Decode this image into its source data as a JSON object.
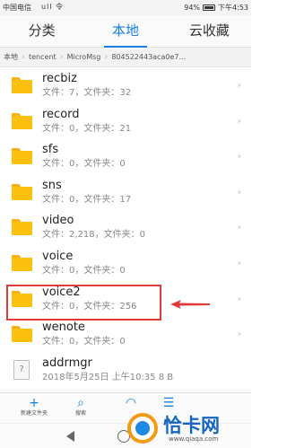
{
  "status_bar": {
    "carrier": "中国电信",
    "signal_icons": "ull 令",
    "battery": "94%",
    "time": "下午4:53"
  },
  "tabs": [
    {
      "label": "分类",
      "active": false
    },
    {
      "label": "本地",
      "active": true
    },
    {
      "label": "云收藏",
      "active": false
    }
  ],
  "breadcrumb": [
    "本地",
    "tencent",
    "MicroMsg",
    "804522443aca0e7..."
  ],
  "items": [
    {
      "name": "recbiz",
      "meta": "文件：7，文件夹：32",
      "type": "folder"
    },
    {
      "name": "record",
      "meta": "文件：0，文件夹：21",
      "type": "folder"
    },
    {
      "name": "sfs",
      "meta": "文件：0，文件夹：0",
      "type": "folder"
    },
    {
      "name": "sns",
      "meta": "文件：0，文件夹：17",
      "type": "folder"
    },
    {
      "name": "video",
      "meta": "文件：2,218，文件夹：0",
      "type": "folder"
    },
    {
      "name": "voice",
      "meta": "文件：0，文件夹：0",
      "type": "folder"
    },
    {
      "name": "voice2",
      "meta": "文件：0，文件夹：256",
      "type": "folder"
    },
    {
      "name": "wenote",
      "meta": "文件：0，文件夹：0",
      "type": "folder"
    },
    {
      "name": "addrmgr",
      "meta": "2018年5月25日 上午10:35 8 B",
      "type": "file"
    }
  ],
  "bottom_bar": [
    {
      "icon": "plus-icon",
      "label": "新建文件夹"
    },
    {
      "icon": "search-icon",
      "label": "搜索"
    },
    {
      "icon": "sort-icon",
      "label": ""
    },
    {
      "icon": "menu-icon",
      "label": ""
    }
  ],
  "watermark": {
    "title": "恰卡网",
    "url": "www.qiaqa.com"
  },
  "colors": {
    "accent": "#1a7fe0",
    "folder": "#fdc00f",
    "highlight": "#e03a3a"
  }
}
